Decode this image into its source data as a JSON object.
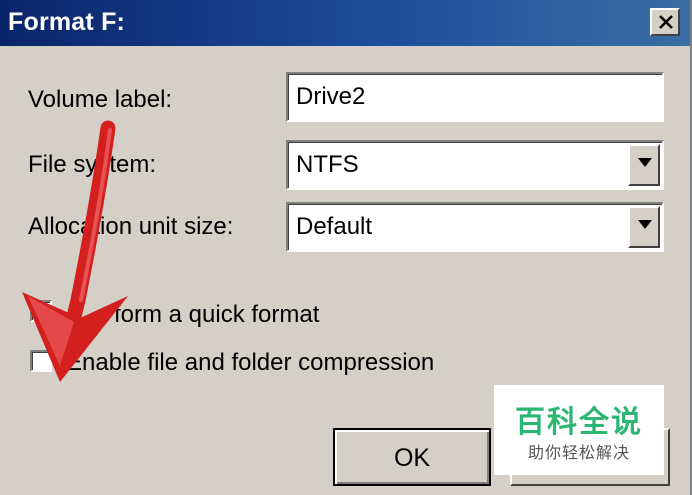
{
  "window": {
    "title": "Format F:",
    "close_icon": "close-icon"
  },
  "form": {
    "volume_label": {
      "label": "Volume label:",
      "value": "Drive2"
    },
    "file_system": {
      "label": "File system:",
      "value": "NTFS"
    },
    "allocation_unit_size": {
      "label": "Allocation unit size:",
      "value": "Default"
    }
  },
  "options": {
    "quick_format": {
      "label": "Perform a quick format",
      "visible_text": "form a quick format",
      "checked": true
    },
    "compression": {
      "label": "Enable file and folder compression",
      "checked": false
    }
  },
  "buttons": {
    "ok": "OK"
  },
  "watermark": {
    "title": "百科全说",
    "subtitle": "助你轻松解决"
  },
  "colors": {
    "titlebar": "#0a246a",
    "dialog_bg": "#d4d0c8",
    "arrow": "#d41f1f",
    "watermark_green": "#2bb673"
  }
}
